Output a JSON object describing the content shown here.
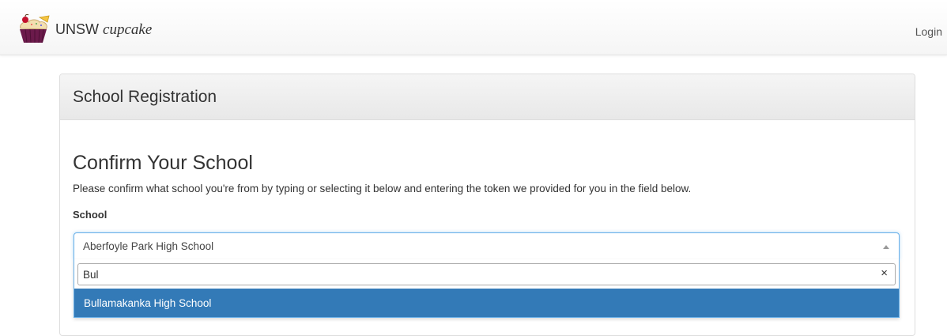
{
  "header": {
    "brand_primary": "UNSW",
    "brand_secondary": "cupcake",
    "login_label": "Login"
  },
  "panel": {
    "title": "School Registration"
  },
  "form": {
    "section_title": "Confirm Your School",
    "help_text": "Please confirm what school you're from by typing or selecting it below and entering the token we provided for you in the field below.",
    "school_label": "School",
    "selected_school": "Aberfoyle Park High School",
    "search_value": "Bul",
    "clear_symbol": "×",
    "options": [
      "Bullamakanka High School"
    ]
  },
  "colors": {
    "highlight": "#337ab7",
    "focus_border": "#66afe9"
  },
  "icons": {
    "logo": "cupcake-logo-icon",
    "select_arrow": "caret-up-icon",
    "clear": "close-icon"
  }
}
